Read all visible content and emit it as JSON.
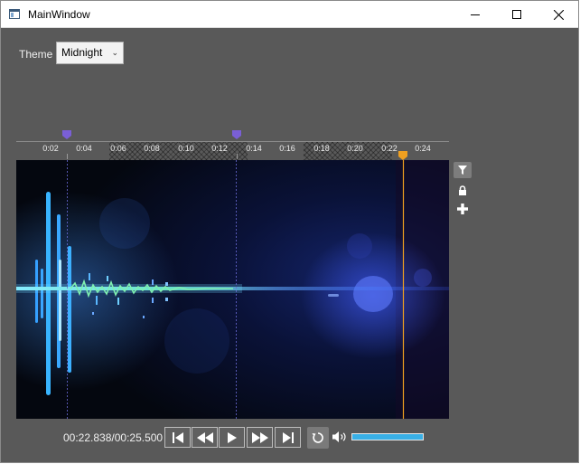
{
  "window": {
    "title": "MainWindow",
    "icons": [
      "app-icon",
      "minimize-icon",
      "maximize-icon",
      "close-icon"
    ]
  },
  "theme": {
    "label": "Theme",
    "selected": "Midnight"
  },
  "timeline": {
    "ticks": [
      "0:02",
      "0:04",
      "0:06",
      "0:08",
      "0:10",
      "0:12",
      "0:14",
      "0:16",
      "0:18",
      "0:20",
      "0:22",
      "0:24"
    ],
    "selection_markers": [
      "marker-left",
      "marker-right"
    ],
    "playhead_color": "#f0a020",
    "marker_color": "#7a5fd6"
  },
  "side_tools": [
    "filter-icon",
    "lock-icon",
    "plus-icon"
  ],
  "player": {
    "time": "00:22.838/00:25.500",
    "volume_level": 1.0,
    "accent_color": "#39b0e6",
    "controls": [
      "skip-start-icon",
      "rewind-icon",
      "play-icon",
      "fast-forward-icon",
      "skip-end-icon",
      "loop-icon",
      "volume-icon"
    ]
  }
}
